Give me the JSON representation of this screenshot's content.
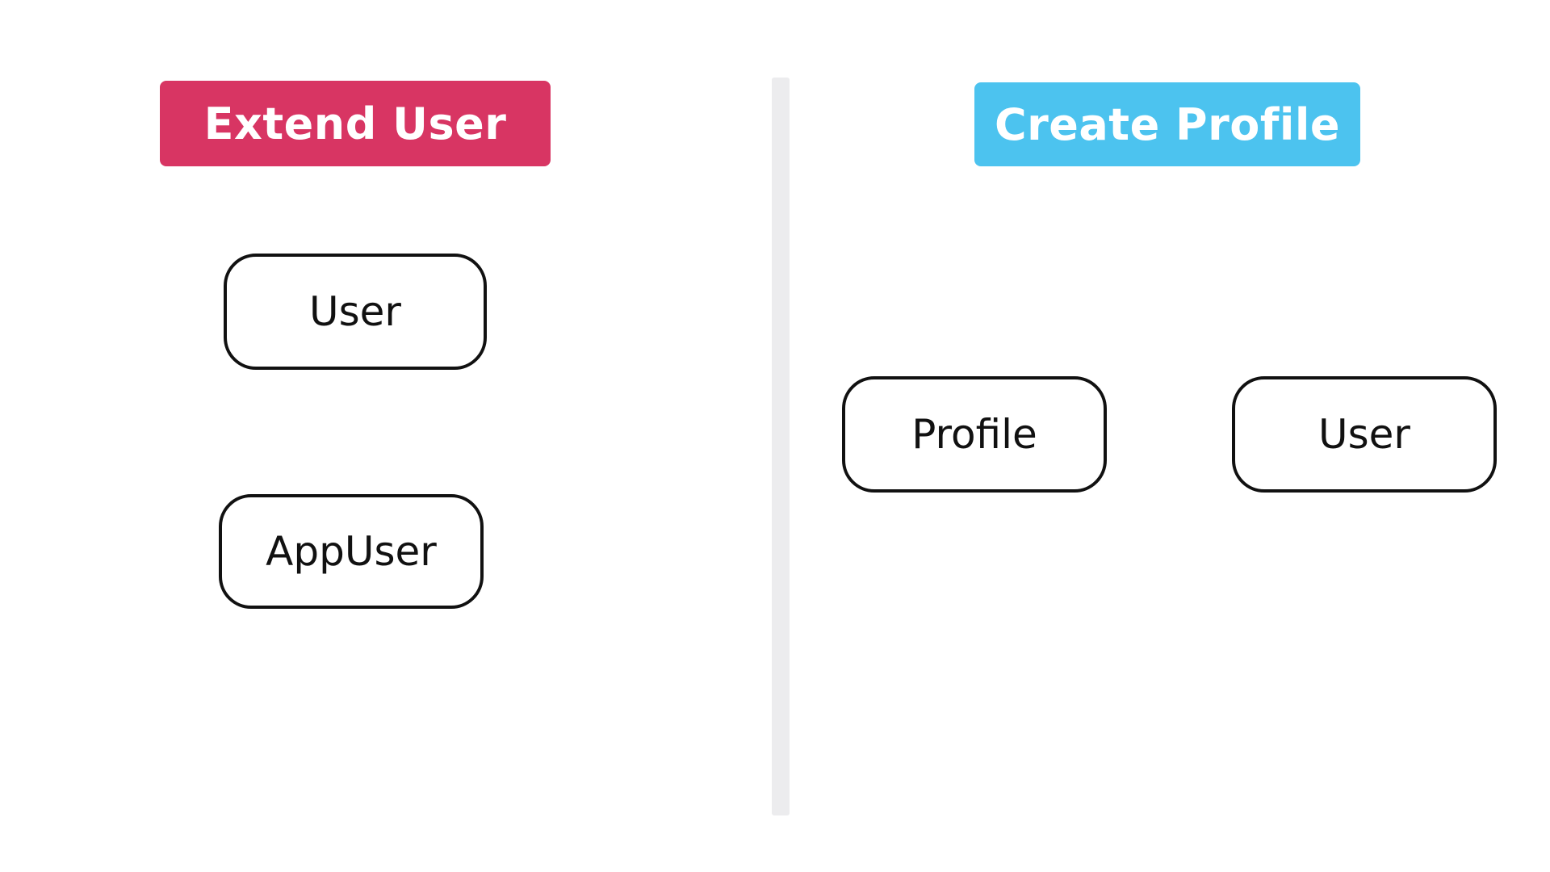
{
  "left_panel": {
    "header_label": "Extend User",
    "header_color": "#d83563",
    "nodes": [
      "User",
      "AppUser"
    ]
  },
  "right_panel": {
    "header_label": "Create Profile",
    "header_color": "#4cc3ef",
    "nodes": [
      "Profile",
      "User"
    ]
  },
  "divider_color": "#ececee",
  "node_border_color": "#111111"
}
